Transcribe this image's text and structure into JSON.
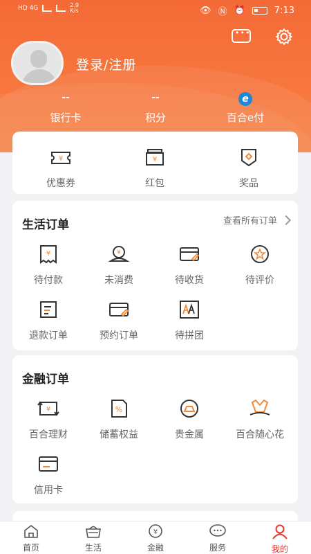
{
  "status_bar": {
    "network_speed": "2.9\nK/s",
    "time": "7:13",
    "battery": "1"
  },
  "profile": {
    "login_label": "登录/注册"
  },
  "stats": [
    {
      "value": "--",
      "label": "银行卡"
    },
    {
      "value": "--",
      "label": "积分"
    },
    {
      "value": "",
      "label": "百合e付"
    }
  ],
  "quick_actions": [
    {
      "label": "优惠券",
      "icon": "coupon-icon"
    },
    {
      "label": "红包",
      "icon": "red-packet-icon"
    },
    {
      "label": "奖品",
      "icon": "prize-icon"
    }
  ],
  "life_orders": {
    "title": "生活订单",
    "view_all": "查看所有订单",
    "items": [
      {
        "label": "待付款",
        "icon": "pending-payment-icon"
      },
      {
        "label": "未消费",
        "icon": "unused-icon"
      },
      {
        "label": "待收货",
        "icon": "pending-receipt-icon"
      },
      {
        "label": "待评价",
        "icon": "pending-review-icon"
      },
      {
        "label": "退款订单",
        "icon": "refund-icon"
      },
      {
        "label": "预约订单",
        "icon": "reservation-icon"
      },
      {
        "label": "待拼团",
        "icon": "group-buy-icon"
      }
    ]
  },
  "finance_orders": {
    "title": "金融订单",
    "items": [
      {
        "label": "百合理财",
        "icon": "wealth-management-icon"
      },
      {
        "label": "储蓄权益",
        "icon": "savings-icon"
      },
      {
        "label": "贵金属",
        "icon": "precious-metal-icon"
      },
      {
        "label": "百合随心花",
        "icon": "credit-flower-icon"
      },
      {
        "label": "信用卡",
        "icon": "credit-card-icon"
      }
    ]
  },
  "tabs": [
    {
      "label": "首页",
      "icon": "home-icon"
    },
    {
      "label": "生活",
      "icon": "life-basket-icon"
    },
    {
      "label": "金融",
      "icon": "finance-icon"
    },
    {
      "label": "服务",
      "icon": "service-chat-icon"
    },
    {
      "label": "我的",
      "icon": "profile-icon",
      "active": true
    }
  ],
  "colors": {
    "accent": "#f46a36",
    "active_tab": "#e8352b",
    "icon_orange": "#f08a3a",
    "icon_dark": "#333333"
  }
}
